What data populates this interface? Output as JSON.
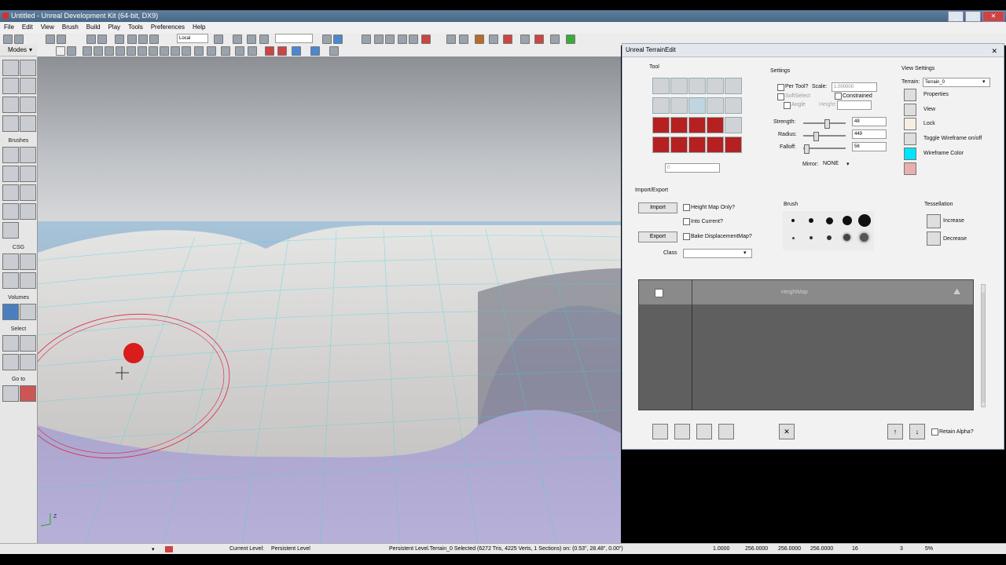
{
  "app": {
    "title": "Untitled - Unreal Development Kit (64-bit, DX9)"
  },
  "menu": [
    "File",
    "Edit",
    "View",
    "Brush",
    "Build",
    "Play",
    "Tools",
    "Preferences",
    "Help"
  ],
  "toolbar": {
    "coord_system": "Local"
  },
  "modes_panel": {
    "title": "Modes",
    "sections": [
      "Brushes",
      "CSG",
      "Volumes",
      "Select",
      "Go to"
    ]
  },
  "viewport": {
    "axis_z": "Z"
  },
  "status": {
    "current_level": "Current Level:",
    "level_name": "Persistent Level",
    "selection": "Persistent Level.Terrain_0 Selected (6272 Tris, 4225 Verts, 1 Sections) on: (0.53\", 28.48\", 0.00\")",
    "v1": "1.0000",
    "v2": "256.0000",
    "v3": "256.0000",
    "v4": "256.0000",
    "grid": "16",
    "snap": "3",
    "pct": "5%"
  },
  "terrain": {
    "title": "Unreal TerrainEdit",
    "tool_label": "Tool",
    "tool_value": "0",
    "settings": {
      "label": "Settings",
      "per_tool": "Per Tool?",
      "scale_label": "Scale:",
      "scale_value": "1.000000",
      "soft_select": "SoftSelect",
      "constrained": "Constrained",
      "angle": "Angle",
      "height": "Height:",
      "strength_label": "Strength:",
      "strength_value": "48",
      "strength_pct": 0.55,
      "radius_label": "Radius:",
      "radius_value": "449",
      "radius_pct": 0.3,
      "falloff_label": "Falloff:",
      "falloff_value": "56",
      "falloff_pct": 0.08,
      "mirror_label": "Mirror:",
      "mirror_value": "NONE"
    },
    "view_settings": {
      "label": "View Settings",
      "terrain_label": "Terrain:",
      "terrain_value": "Terrain_0",
      "properties": "Properties",
      "view": "View",
      "lock": "Lock",
      "toggle_wireframe": "Toggle Wireframe on/off",
      "wireframe_color": "Wireframe Color",
      "wire_color": "#00e5ff"
    },
    "import_export": {
      "label": "Import/Export",
      "import": "Import",
      "export": "Export",
      "height_only": "Height Map Only?",
      "into_current": "Into Current?",
      "bake": "Bake DisplacementMap?",
      "class": "Class"
    },
    "brush_label": "Brush",
    "tessellation": {
      "label": "Tessellation",
      "increase": "Increase",
      "decrease": "Decrease"
    },
    "layers": {
      "heightmap": "HeightMap"
    },
    "retain_alpha": "Retain Alpha?"
  }
}
